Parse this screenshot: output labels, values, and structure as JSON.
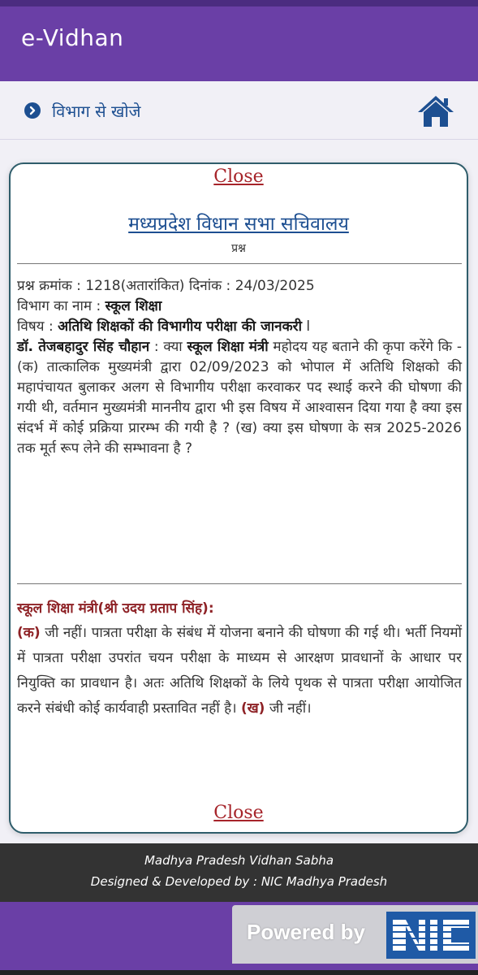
{
  "app": {
    "title": "e-Vidhan"
  },
  "nav": {
    "search_by_department": "विभाग से खोजे"
  },
  "card": {
    "close_label": "Close",
    "secretariat": "मध्यप्रदेश विधान सभा सचिवालय",
    "section": "प्रश्न",
    "question_meta": "प्रश्न क्रमांक : 1218(अतारांकित) दिनांक : 24/03/2025",
    "department_label": "विभाग का नाम :",
    "department_value": "स्कूल शिक्षा",
    "subject_label": "विषय :",
    "subject_value": "अतिथि शिक्षकों की विभागीय परीक्षा की जानकरी",
    "subject_end": " l",
    "asker": "डॉ. तेजबहादुर सिंह चौहान",
    "kya": " : क्या ",
    "addressed_minister": "स्कूल शिक्षा मंत्री",
    "question_text": " महोदय यह बताने की कृपा करेंगे कि - (क) तात्कालिक मुख्यमंत्री द्वारा 02/09/2023 को भोपाल में अतिथि शिक्षको की महापंचायत बुलाकर अलग से विभागीय परीक्षा करवाकर पद स्थाई करने की घोषणा की गयी थी, वर्तमान मुख्यमंत्री माननीय द्वारा भी इस विषय में आश्वासन दिया गया है क्या इस संदर्भ में कोई प्रक्रिया प्रारम्भ की गयी है ? (ख) क्या इस घोषणा के सत्र 2025-2026 तक मूर्त रूप लेने की सम्भावना है ?",
    "answer_minister": "स्कूल शिक्षा मंत्री(श्री उदय प्रताप सिंह):",
    "answer_ka": "(क)",
    "answer_text_1": " जी नहीं। पात्रता परीक्षा के संबंध में योजना बनाने की घोषणा की गई थी। भर्ती नियमों में पात्रता परीक्षा उपरांत चयन परीक्षा के माध्यम से आरक्षण प्रावधानों के आधार पर नियुक्ति का प्रावधान है। अतः अतिथि शिक्षकों के लिये पृथक से पात्रता परीक्षा आयोजित करने संबंधी कोई कार्यवाही प्रस्तावित नहीं है। ",
    "answer_kha": "(ख)",
    "answer_text_2": " जी नहीं।"
  },
  "footer": {
    "line1": "Madhya Pradesh Vidhan Sabha",
    "line2": "Designed & Developed by : NIC Madhya Pradesh"
  },
  "brand": {
    "powered_by": "Powered by",
    "logo": "NIC"
  },
  "colors": {
    "appbar": "#6a3fa6",
    "link_blue": "#1d4f91",
    "close_red": "#a6242a",
    "answer_red": "#8e2226",
    "footer": "#333333"
  },
  "icons": [
    "chevron-right-circle-icon",
    "home-icon",
    "nic-logo"
  ]
}
